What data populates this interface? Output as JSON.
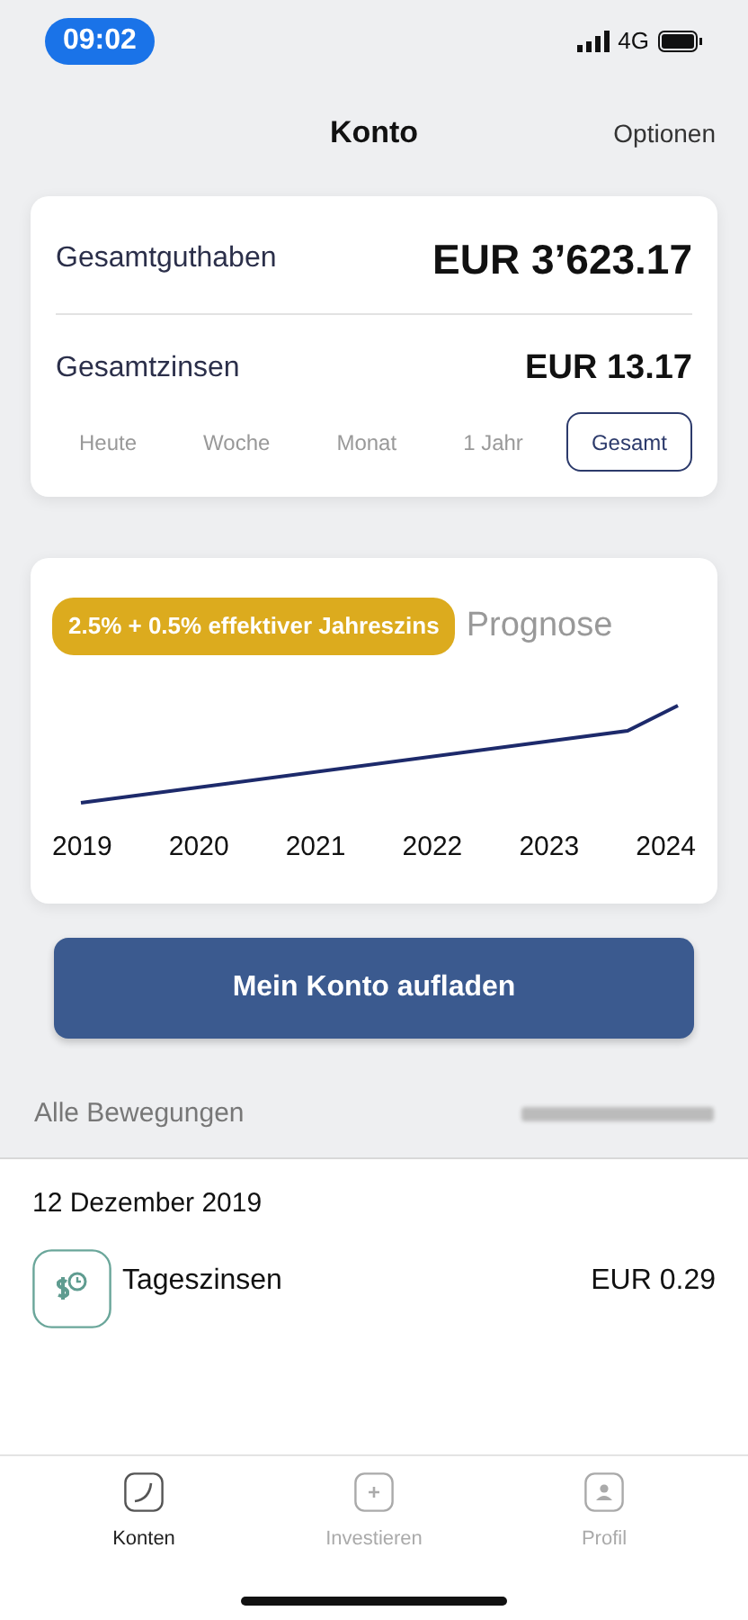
{
  "status_bar": {
    "time": "09:02",
    "network": "4G"
  },
  "header": {
    "title": "Konto",
    "action": "Optionen"
  },
  "summary": {
    "rows": [
      {
        "label": "Gesamtguthaben",
        "value": "EUR 3’623.17",
        "kind": "large"
      },
      {
        "label": "Gesamtzinsen",
        "value": "EUR 13.17",
        "kind": "medium"
      }
    ],
    "periods": [
      {
        "label": "Heute",
        "selected": false
      },
      {
        "label": "Woche",
        "selected": false
      },
      {
        "label": "Monat",
        "selected": false
      },
      {
        "label": "1 Jahr",
        "selected": false
      },
      {
        "label": "Gesamt",
        "selected": true
      }
    ]
  },
  "forecast": {
    "badge": "2.5% + 0.5% effektiver Jahreszins",
    "title": "Prognose",
    "years": [
      "2019",
      "2020",
      "2021",
      "2022",
      "2023",
      "2024"
    ]
  },
  "topup_button": "Mein Konto aufladen",
  "movements": {
    "title": "Alle Bewegungen",
    "groups": [
      {
        "date": "12 Dezember 2019",
        "items": [
          {
            "name": "Tageszinsen",
            "amount": "EUR 0.29"
          }
        ]
      }
    ]
  },
  "tab_bar": [
    {
      "label": "Konten",
      "selected": true,
      "kind": "accounts"
    },
    {
      "label": "Investieren",
      "selected": false,
      "kind": "invest"
    },
    {
      "label": "Profil",
      "selected": false,
      "kind": "profile"
    }
  ]
}
